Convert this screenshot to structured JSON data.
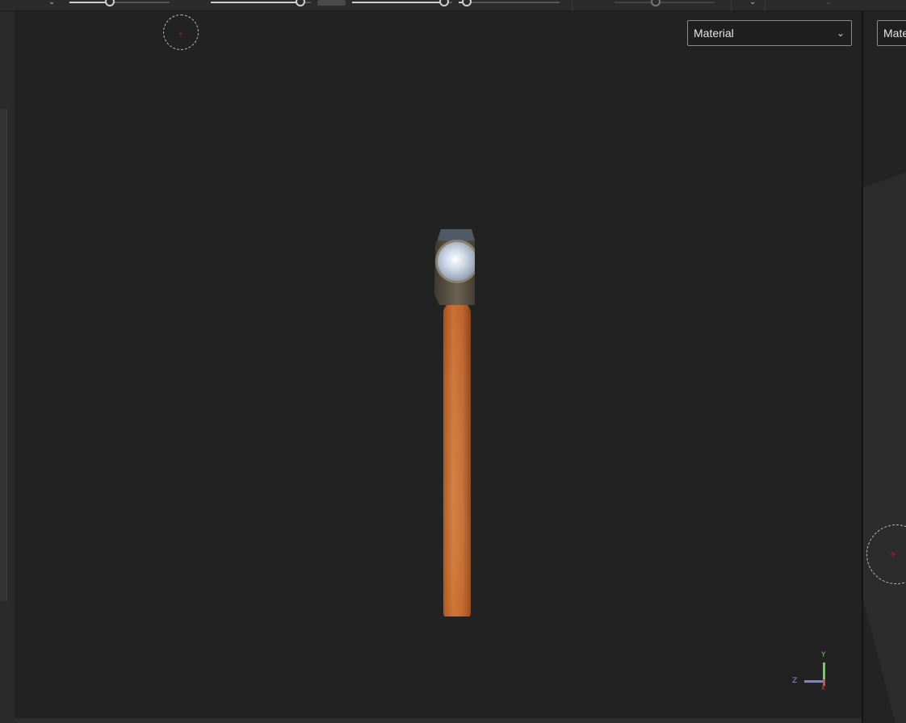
{
  "viewport": {
    "shading_mode": "Material",
    "secondary_shading_mode": "Material",
    "axis_gizmo": {
      "y_label": "Y",
      "z_label": "Z",
      "x_label": "X"
    }
  },
  "toolbar": {
    "sliders": [
      {
        "name": "slider-1",
        "value": 0.4
      },
      {
        "name": "slider-2",
        "value": 1.0
      },
      {
        "name": "slider-3",
        "value": 1.0
      },
      {
        "name": "slider-4",
        "value": 0.05
      },
      {
        "name": "slider-5",
        "value": 0.4
      }
    ]
  },
  "colors": {
    "viewport_bg": "#222222",
    "handle_wood": "#c46a2e",
    "head_metal": "#5a5040",
    "axis_y": "#6fcf5a",
    "axis_z": "#8080e0",
    "axis_x": "#d05050"
  },
  "icons": [
    "chevron-down-icon",
    "light-gizmo-icon",
    "axis-gizmo-icon"
  ]
}
